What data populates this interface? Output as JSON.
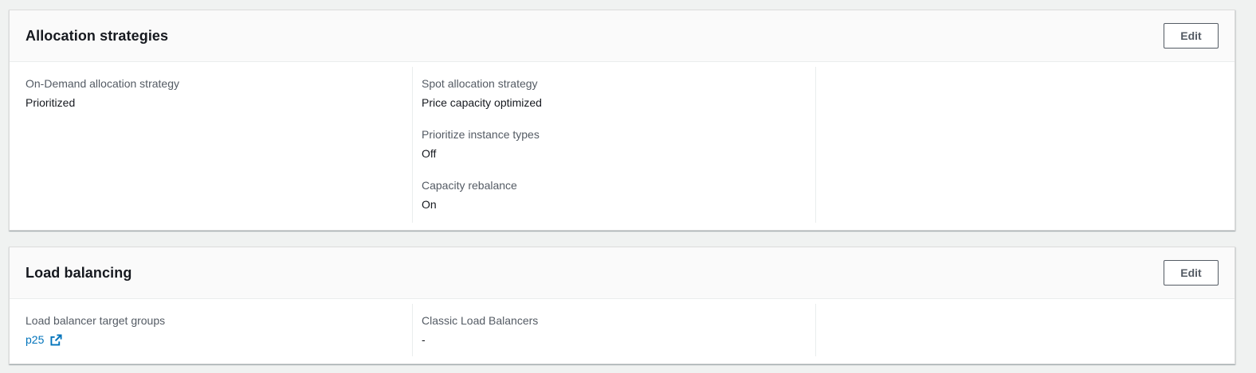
{
  "allocation": {
    "title": "Allocation strategies",
    "edit_label": "Edit",
    "on_demand_label": "On-Demand allocation strategy",
    "on_demand_value": "Prioritized",
    "spot_label": "Spot allocation strategy",
    "spot_value": "Price capacity optimized",
    "prioritize_label": "Prioritize instance types",
    "prioritize_value": "Off",
    "rebalance_label": "Capacity rebalance",
    "rebalance_value": "On"
  },
  "load_balancing": {
    "title": "Load balancing",
    "edit_label": "Edit",
    "target_groups_label": "Load balancer target groups",
    "target_groups_value": "p25",
    "target_groups_icon": "external-link-icon",
    "classic_label": "Classic Load Balancers",
    "classic_value": "-"
  },
  "colors": {
    "link": "#0073bb",
    "label": "#545b64",
    "text": "#16191f",
    "background": "#f0f2f1"
  }
}
